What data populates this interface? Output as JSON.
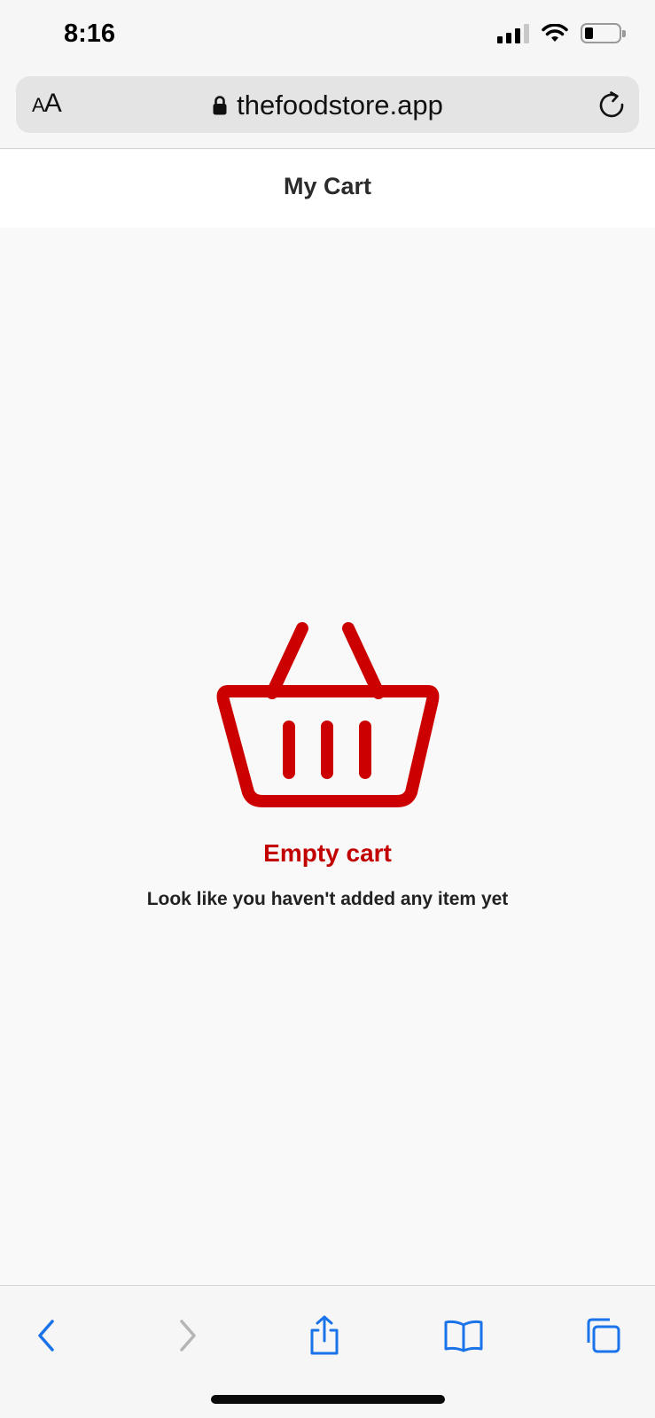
{
  "status_bar": {
    "time": "8:16",
    "icons": [
      "signal-icon",
      "wifi-icon",
      "battery-icon"
    ],
    "battery_level": 0.2
  },
  "browser": {
    "text_size_button_small": "A",
    "text_size_button_large": "A",
    "url": "thefoodstore.app",
    "icons": [
      "lock-icon",
      "reload-icon"
    ]
  },
  "header": {
    "title": "My Cart"
  },
  "empty_state": {
    "icon": "basket-icon",
    "title": "Empty cart",
    "subtitle": "Look like you haven't added any item yet"
  },
  "toolbar": {
    "items": [
      "back-icon",
      "forward-icon",
      "share-icon",
      "bookmarks-icon",
      "tabs-icon"
    ]
  },
  "colors": {
    "accent": "#c20000",
    "link_blue": "#1a73e8",
    "disabled_gray": "#b5b5b5"
  }
}
